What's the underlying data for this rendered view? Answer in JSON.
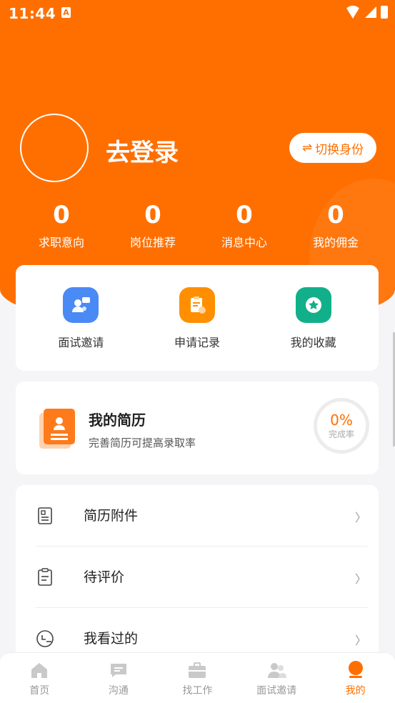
{
  "status_bar": {
    "time": "11:44",
    "badge": "A"
  },
  "profile": {
    "login_text": "去登录",
    "switch_label": "切换身份",
    "switch_icon": "⇌"
  },
  "stats": [
    {
      "value": "0",
      "label": "求职意向"
    },
    {
      "value": "0",
      "label": "岗位推荐"
    },
    {
      "value": "0",
      "label": "消息中心"
    },
    {
      "value": "0",
      "label": "我的佣金"
    }
  ],
  "quick_actions": [
    {
      "label": "面试邀请",
      "icon": "interview-icon",
      "color": "#4a8af4"
    },
    {
      "label": "申请记录",
      "icon": "application-record-icon",
      "color": "#ff8f00"
    },
    {
      "label": "我的收藏",
      "icon": "star-icon",
      "color": "#12b08a"
    }
  ],
  "resume": {
    "title": "我的简历",
    "subtitle": "完善简历可提高录取率",
    "progress": "0%",
    "progress_label": "完成率"
  },
  "menu": [
    {
      "label": "简历附件",
      "icon": "resume-attachment-icon",
      "chevron": "〉"
    },
    {
      "label": "待评价",
      "icon": "clipboard-icon",
      "chevron": "〉"
    },
    {
      "label": "我看过的",
      "icon": "history-icon",
      "chevron": "〉"
    }
  ],
  "tabbar": [
    {
      "label": "首页",
      "icon": "home-icon"
    },
    {
      "label": "沟通",
      "icon": "chat-icon"
    },
    {
      "label": "找工作",
      "icon": "briefcase-icon"
    },
    {
      "label": "面试邀请",
      "icon": "interview-icon"
    },
    {
      "label": "我的",
      "icon": "profile-icon",
      "active": true
    }
  ],
  "colors": {
    "primary": "#ff6f00",
    "background": "#f5f5f7"
  }
}
